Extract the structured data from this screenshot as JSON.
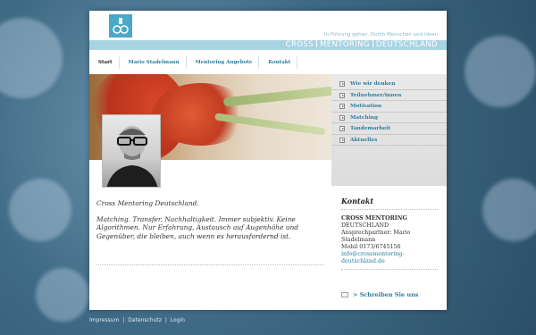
{
  "header": {
    "logo_icon": "cross-mentoring-logo-icon",
    "tagline": "In Führung gehen. Durch Menschen und Ideen.",
    "brand_part1": "CROSS",
    "brand_part2": "MENTORING",
    "brand_part3": "DEUTSCHLAND"
  },
  "nav": {
    "items": [
      {
        "label": "Start",
        "active": true
      },
      {
        "label": "Mario Stadelmann"
      },
      {
        "label": "Mentoring Angebote"
      },
      {
        "label": "Kontakt"
      }
    ]
  },
  "sidebar": {
    "items": [
      {
        "label": "Wie wir denken"
      },
      {
        "label": "Teilnehmer/innen"
      },
      {
        "label": "Motivation"
      },
      {
        "label": "Matching"
      },
      {
        "label": "Tandemarbeit"
      },
      {
        "label": "Aktuelles"
      }
    ]
  },
  "main": {
    "title": "Cross Mentoring Deutschland.",
    "body": "Matching. Transfer. Nachhaltigkeit. Immer subjektiv.  Keine Algorithmen. Nur Erfahrung, Austausch auf Augenhöhe und Gegenüber, die bleiben, auch wenn es herausfordernd ist."
  },
  "contact": {
    "heading": "Kontakt",
    "org_line1": "CROSS MENTORING",
    "org_line2": "DEUTSCHLAND",
    "person": "Ansprechpartner: Mario Stadelmann",
    "phone": "Mobil   0173/6745156",
    "email": "info@crossmentoring-deutschland.de",
    "write_label": "> Schreiben Sie uns"
  },
  "footer": {
    "impressum": "Impressum",
    "datenschutz": "Datenschutz",
    "login": "Login",
    "separator": "|"
  },
  "colors": {
    "accent": "#2a7ea0",
    "brand_bar": "#a8d3e2",
    "logo": "#4aa8c8"
  }
}
